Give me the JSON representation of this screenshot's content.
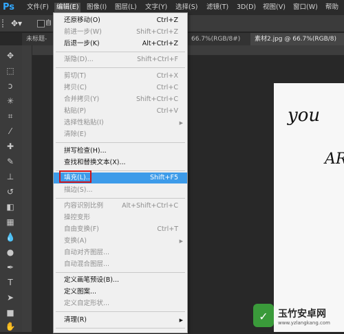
{
  "app": {
    "logo": "Ps"
  },
  "menubar": {
    "items": [
      "文件(F)",
      "编辑(E)",
      "图像(I)",
      "图层(L)",
      "文字(Y)",
      "选择(S)",
      "滤镜(T)",
      "3D(D)",
      "视图(V)",
      "窗口(W)",
      "帮助"
    ],
    "active": "编辑(E)"
  },
  "tabs": [
    {
      "label": "未标题-"
    },
    {
      "label": "66.7%(RGB/8#)"
    },
    {
      "label": "素材2.jpg @ 66.7%(RGB/8)"
    }
  ],
  "edit_menu": {
    "items": [
      {
        "label": "还原移动(O)",
        "shortcut": "Ctrl+Z",
        "disabled": false
      },
      {
        "label": "前进一步(W)",
        "shortcut": "Shift+Ctrl+Z",
        "disabled": true
      },
      {
        "label": "后退一步(K)",
        "shortcut": "Alt+Ctrl+Z",
        "disabled": false
      },
      {
        "label": "渐隐(D)...",
        "shortcut": "Shift+Ctrl+F",
        "disabled": true
      },
      {
        "label": "剪切(T)",
        "shortcut": "Ctrl+X",
        "disabled": true
      },
      {
        "label": "拷贝(C)",
        "shortcut": "Ctrl+C",
        "disabled": true
      },
      {
        "label": "合并拷贝(Y)",
        "shortcut": "Shift+Ctrl+C",
        "disabled": true
      },
      {
        "label": "粘贴(P)",
        "shortcut": "Ctrl+V",
        "disabled": true
      },
      {
        "label": "选择性粘贴(I)",
        "shortcut": "",
        "disabled": true,
        "submenu": true
      },
      {
        "label": "清除(E)",
        "shortcut": "",
        "disabled": true
      },
      {
        "label": "拼写检查(H)...",
        "shortcut": "",
        "disabled": false
      },
      {
        "label": "查找和替换文本(X)...",
        "shortcut": "",
        "disabled": false
      },
      {
        "label": "填充(L)...",
        "shortcut": "Shift+F5",
        "disabled": false,
        "highlighted": true
      },
      {
        "label": "描边(S)...",
        "shortcut": "",
        "disabled": true
      },
      {
        "label": "内容识别比例",
        "shortcut": "Alt+Shift+Ctrl+C",
        "disabled": true
      },
      {
        "label": "操控变形",
        "shortcut": "",
        "disabled": true
      },
      {
        "label": "自由变换(F)",
        "shortcut": "Ctrl+T",
        "disabled": true
      },
      {
        "label": "变换(A)",
        "shortcut": "",
        "disabled": true,
        "submenu": true
      },
      {
        "label": "自动对齐图层...",
        "shortcut": "",
        "disabled": true
      },
      {
        "label": "自动混合图层...",
        "shortcut": "",
        "disabled": true
      },
      {
        "label": "定义画笔预设(B)...",
        "shortcut": "",
        "disabled": false
      },
      {
        "label": "定义图案...",
        "shortcut": "",
        "disabled": false
      },
      {
        "label": "定义自定形状...",
        "shortcut": "",
        "disabled": true
      },
      {
        "label": "清理(R)",
        "shortcut": "",
        "disabled": false,
        "submenu": true
      }
    ]
  },
  "canvas": {
    "text_1": "you",
    "text_2": "AR"
  },
  "watermark": {
    "title": "玉竹安卓网",
    "url": "www.yzlangkang.com"
  },
  "colors": {
    "accent": "#3d9be9",
    "highlight_box": "#d0141a",
    "ps_blue": "#31a8ff"
  }
}
